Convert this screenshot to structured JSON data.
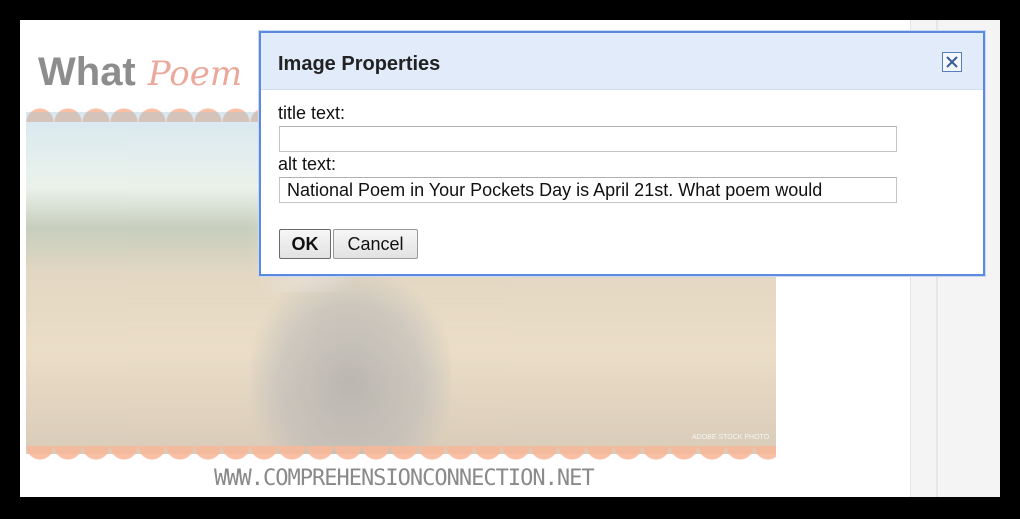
{
  "background_page": {
    "blog_title_main": "What",
    "blog_title_script": "Poem",
    "photo_credit": "ADOBE STOCK PHOTO",
    "site_url": "WWW.COMPREHENSIONCONNECTION.NET"
  },
  "dialog": {
    "title": "Image Properties",
    "close_icon": "close-icon",
    "fields": {
      "title_label": "title text:",
      "title_value": "",
      "alt_label": "alt text:",
      "alt_value": "National Poem in Your Pockets Day is April 21st. What poem would"
    },
    "buttons": {
      "ok_label": "OK",
      "cancel_label": "Cancel"
    }
  },
  "colors": {
    "dialog_border": "#5b8ae0",
    "dialog_header_bg": "#e1ebfa",
    "scallop_accent": "#f7b89a"
  }
}
